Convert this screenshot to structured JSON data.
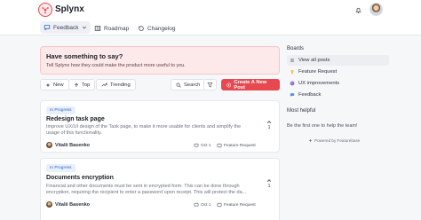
{
  "app": {
    "name": "Splynx"
  },
  "nav": {
    "feedback": "Feedback",
    "roadmap": "Roadmap",
    "changelog": "Changelog"
  },
  "banner": {
    "title": "Have something to say?",
    "subtitle": "Tell Splynx how they could make the product more useful to you."
  },
  "filters": {
    "new": "New",
    "top": "Top",
    "trending": "Trending",
    "search": "Search",
    "create": "Create A New Post"
  },
  "posts": [
    {
      "status": "In Progress",
      "title": "Redesign task page",
      "body": "Improve UX/UI design of the Task page, to make it more usable for clients and simplify the usage of this functionality.",
      "author": "Vitalii Basenko",
      "date": "Oct 1",
      "category": "Feature Request",
      "votes": "1"
    },
    {
      "status": "In Progress",
      "title": "Documents encryption",
      "body": "Financial and other documents must be sent in encrypted form. This can be done through encryption, requiring the recipient to enter a password upon receipt. This will protect the da...",
      "author": "Vitalii Basenko",
      "date": "Oct 1",
      "category": "Feature Request",
      "votes": "1"
    }
  ],
  "sidebar": {
    "boards_heading": "Boards",
    "boards": [
      "View all posts",
      "Feature Request",
      "UX improvements",
      "Feedback"
    ],
    "helpful_heading": "Most helpful",
    "helpful_text": "Be the first one to help the team!",
    "powered": "Powered by Featurebase"
  },
  "colors": {
    "accent": "#e8484f",
    "banner_bg": "#fde9ea",
    "badge_bg": "#e8f0fe",
    "badge_text": "#3465c9"
  },
  "icons": {
    "logo": "splynx-logo-icon",
    "bell": "bell-icon",
    "feedback": "feedback-icon",
    "roadmap": "roadmap-icon",
    "changelog": "changelog-icon"
  }
}
